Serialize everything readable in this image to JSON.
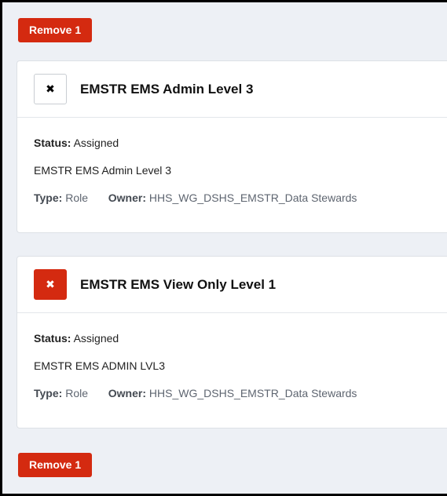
{
  "buttons": {
    "remove_top": "Remove 1",
    "remove_bottom": "Remove 1"
  },
  "colors": {
    "accent_red": "#d42a10",
    "background": "#edf0f5",
    "card": "#ffffff"
  },
  "cards": [
    {
      "toggle_icon": "close-icon",
      "toggle_glyph": "✖",
      "selected": false,
      "title": "EMSTR EMS Admin Level 3",
      "status_label": "Status:",
      "status_value": "Assigned",
      "description": "EMSTR EMS Admin Level 3",
      "type_label": "Type:",
      "type_value": "Role",
      "owner_label": "Owner:",
      "owner_value": "HHS_WG_DSHS_EMSTR_Data Stewards"
    },
    {
      "toggle_icon": "close-icon",
      "toggle_glyph": "✖",
      "selected": true,
      "title": "EMSTR EMS View Only Level 1",
      "status_label": "Status:",
      "status_value": "Assigned",
      "description": "EMSTR EMS ADMIN LVL3",
      "type_label": "Type:",
      "type_value": "Role",
      "owner_label": "Owner:",
      "owner_value": "HHS_WG_DSHS_EMSTR_Data Stewards"
    }
  ]
}
